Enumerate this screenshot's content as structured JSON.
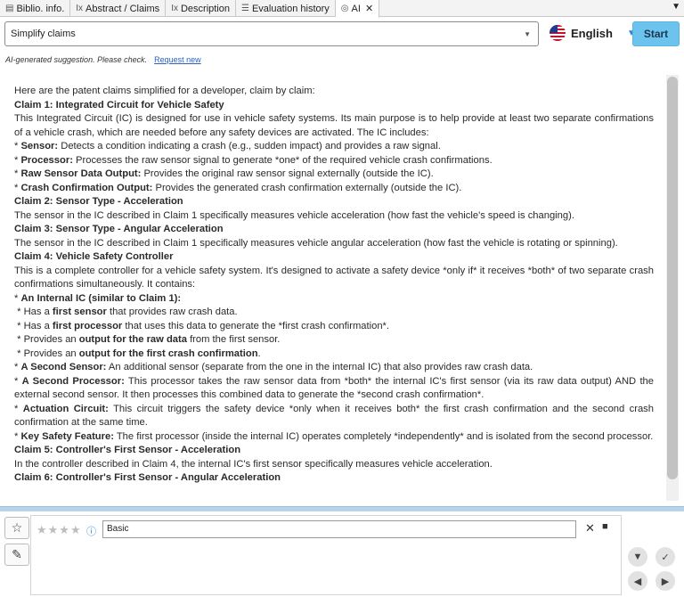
{
  "tabs": [
    {
      "label": "Biblio. info.",
      "icon": "document-icon"
    },
    {
      "label": "Abstract / Claims",
      "icon": "text-format-icon"
    },
    {
      "label": "Description",
      "icon": "text-format-icon"
    },
    {
      "label": "Evaluation history",
      "icon": "list-icon"
    },
    {
      "label": "AI",
      "icon": "ai-icon",
      "active": true
    }
  ],
  "toolbar": {
    "mode": "Simplify claims",
    "language": "English",
    "start": "Start"
  },
  "hint": {
    "text": "AI-generated suggestion. Please check.",
    "link": "Request new"
  },
  "result": {
    "intro": "Here are the patent claims simplified for a developer, claim by claim:",
    "c1_title": "Claim 1: Integrated Circuit for Vehicle Safety",
    "c1_body": "This Integrated Circuit (IC) is designed for use in vehicle safety systems. Its main purpose is to help provide at least two separate confirmations of a vehicle crash, which are needed before any safety devices are activated. The IC includes:",
    "c1_b1_k": "Sensor:",
    "c1_b1_v": " Detects a condition indicating a crash (e.g., sudden impact) and provides a raw signal.",
    "c1_b2_k": "Processor:",
    "c1_b2_v": " Processes the raw sensor signal to generate *one* of the required vehicle crash confirmations.",
    "c1_b3_k": "Raw Sensor Data Output:",
    "c1_b3_v": " Provides the original raw sensor signal externally (outside the IC).",
    "c1_b4_k": "Crash Confirmation Output:",
    "c1_b4_v": " Provides the generated crash confirmation externally (outside the IC).",
    "c2_title": "Claim 2: Sensor Type - Acceleration",
    "c2_body": "The sensor in the IC described in Claim 1 specifically measures vehicle acceleration (how fast the vehicle's speed is changing).",
    "c3_title": "Claim 3: Sensor Type - Angular Acceleration",
    "c3_body": "The sensor in the IC described in Claim 1 specifically measures vehicle angular acceleration (how fast the vehicle is rotating or spinning).",
    "c4_title": "Claim 4: Vehicle Safety Controller",
    "c4_body": "This is a complete controller for a vehicle safety system. It's designed to activate a safety device *only if* it receives *both* of two separate crash confirmations simultaneously. It contains:",
    "c4_b1_k": "An Internal IC (similar to Claim 1):",
    "c4_s1_a": " Has a ",
    "c4_s1_k": "first sensor",
    "c4_s1_b": " that provides raw crash data.",
    "c4_s2_a": " Has a ",
    "c4_s2_k": "first processor",
    "c4_s2_b": " that uses this data to generate the *first crash confirmation*.",
    "c4_s3_a": " Provides an ",
    "c4_s3_k": "output for the raw data",
    "c4_s3_b": " from the first sensor.",
    "c4_s4_a": " Provides an ",
    "c4_s4_k": "output for the first crash confirmation",
    "c4_s4_b": ".",
    "c4_b2_k": "A Second Sensor:",
    "c4_b2_v": " An additional sensor (separate from the one in the internal IC) that also provides raw crash data.",
    "c4_b3_k": "A Second Processor:",
    "c4_b3_v": " This processor takes the raw sensor data from *both* the internal IC's first sensor (via its raw data output) AND the external second sensor. It then processes this combined data to generate the *second crash confirmation*.",
    "c4_b4_k": "Actuation Circuit:",
    "c4_b4_v": " This circuit triggers the safety device *only when it receives both* the first crash confirmation and the second crash confirmation at the same time.",
    "c4_b5_k": "Key Safety Feature:",
    "c4_b5_v": " The first processor (inside the internal IC) operates completely *independently* and is isolated from the second processor.",
    "c5_title": "Claim 5: Controller's First Sensor - Acceleration",
    "c5_body": "In the controller described in Claim 4, the internal IC's first sensor specifically measures vehicle acceleration.",
    "c6_title": "Claim 6: Controller's First Sensor - Angular Acceleration"
  },
  "evaluation": {
    "stars": "★★★★",
    "rating_count": 4,
    "comment": "Basic"
  },
  "icons": {
    "side1": "user-star-icon",
    "side2": "comment-icon",
    "thumbs": "thumbs-down-icon",
    "check": "check-icon",
    "prev": "previous-icon",
    "next": "next-icon"
  }
}
